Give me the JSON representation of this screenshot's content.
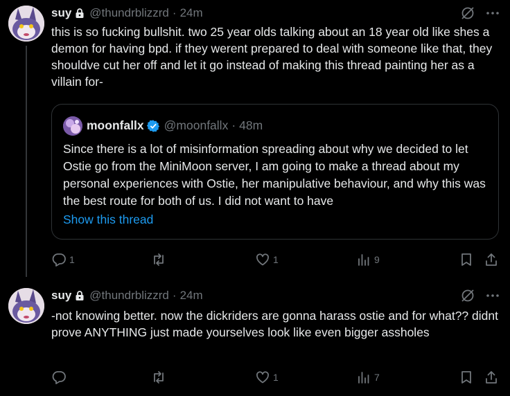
{
  "tweets": [
    {
      "name": "suy",
      "handle": "@thundrblizzrd",
      "time": "24m",
      "text": "this is so fucking bullshit. two 25 year olds talking about an 18 year old like shes a demon for having bpd. if they werent prepared to deal with someone like that, they shouldve cut her off and let it go instead of making this thread painting her as a villain for-",
      "quote": {
        "name": "moonfallx",
        "handle": "@moonfallx",
        "time": "48m",
        "text": "Since there is a lot of misinformation spreading about why we decided to let Ostie go from the MiniMoon server, I am going to make a thread about my personal experiences with Ostie, her manipulative behaviour, and why this was the best route for both of us. I did not want to have",
        "show_thread": "Show this thread"
      },
      "replies": "1",
      "retweets": "",
      "likes": "1",
      "views": "9"
    },
    {
      "name": "suy",
      "handle": "@thundrblizzrd",
      "time": "24m",
      "text": "-not knowing better. now the dickriders are gonna harass ostie and for what?? didnt prove ANYTHING just made yourselves look like even bigger assholes",
      "replies": "",
      "retweets": "",
      "likes": "1",
      "views": "7"
    }
  ],
  "icons": {
    "lock": "lock-icon",
    "grok": "grok-icon",
    "more": "more-icon",
    "verified": "verified-badge-icon",
    "reply": "reply-icon",
    "retweet": "retweet-icon",
    "like": "like-icon",
    "views": "views-icon",
    "bookmark": "bookmark-icon",
    "share": "share-icon"
  },
  "colors": {
    "background": "#000000",
    "text": "#e7e9ea",
    "muted": "#71767b",
    "link": "#1d9bf0",
    "border": "#2f3336"
  }
}
